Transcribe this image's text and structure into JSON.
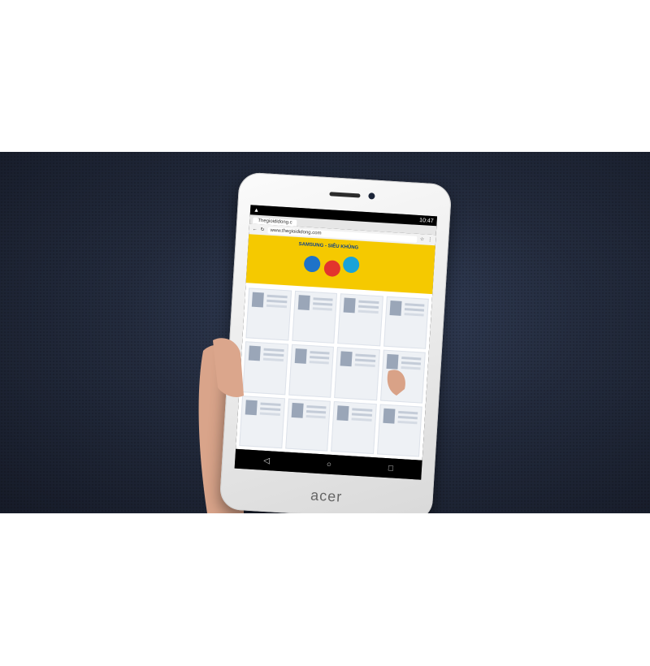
{
  "status_bar": {
    "time": "10:47"
  },
  "browser": {
    "tab_title": "Thegioididong.c",
    "url": "www.thegioididong.com"
  },
  "banner": {
    "promo": "SAMSUNG - SIÊU KHỦNG"
  },
  "navigation": {
    "back_icon": "◁",
    "home_icon": "○",
    "recents_icon": "□"
  },
  "device": {
    "brand": "acer"
  },
  "colors": {
    "banner": "#f5c900",
    "background": "#1e2535",
    "tablet": "#ececec"
  }
}
